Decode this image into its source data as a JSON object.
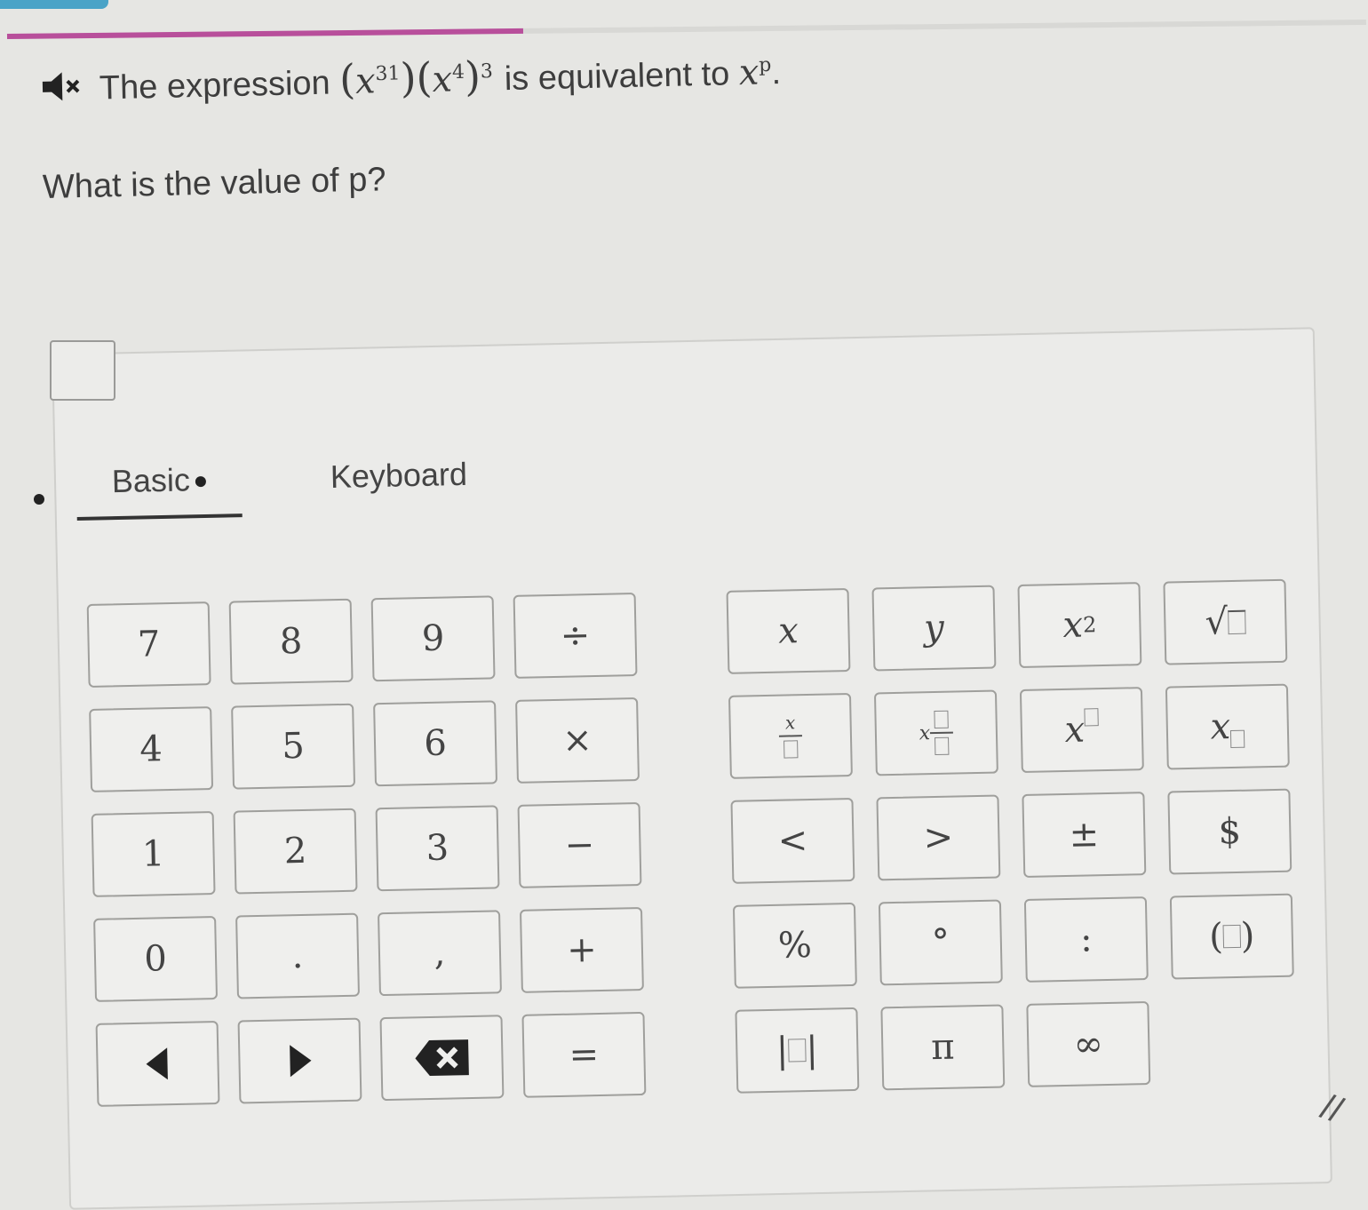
{
  "question": {
    "text_before": "The expression",
    "math_base": "x",
    "exp1": "31",
    "exp2": "4",
    "outer_exp": "3",
    "text_mid": "is equivalent to",
    "target_exp": "p",
    "text_end": ".",
    "prompt": "What is the value of p?"
  },
  "progress": {
    "fraction": 0.38,
    "color": "#b84f9b"
  },
  "tabs": [
    {
      "label": "Basic",
      "active": true
    },
    {
      "label": "Keyboard",
      "active": false
    }
  ],
  "numpad": {
    "k7": "7",
    "k8": "8",
    "k9": "9",
    "div": "÷",
    "k4": "4",
    "k5": "5",
    "k6": "6",
    "mul": "×",
    "k1": "1",
    "k2": "2",
    "k3": "3",
    "minus": "−",
    "k0": "0",
    "dot": ".",
    "comma": ",",
    "plus": "+",
    "equals": "="
  },
  "symbols": {
    "x": "x",
    "y": "y",
    "x2_base": "x",
    "x2_exp": "2",
    "sqrt": "√",
    "frac_top": "x",
    "mixed_lead": "x",
    "pow_base": "x",
    "sub_base": "x",
    "lt": "<",
    "gt": ">",
    "pm": "±",
    "dollar": "$",
    "percent": "%",
    "degree": "°",
    "colon": ":",
    "abs_bar": "|",
    "pi": "π",
    "infinity": "∞"
  }
}
